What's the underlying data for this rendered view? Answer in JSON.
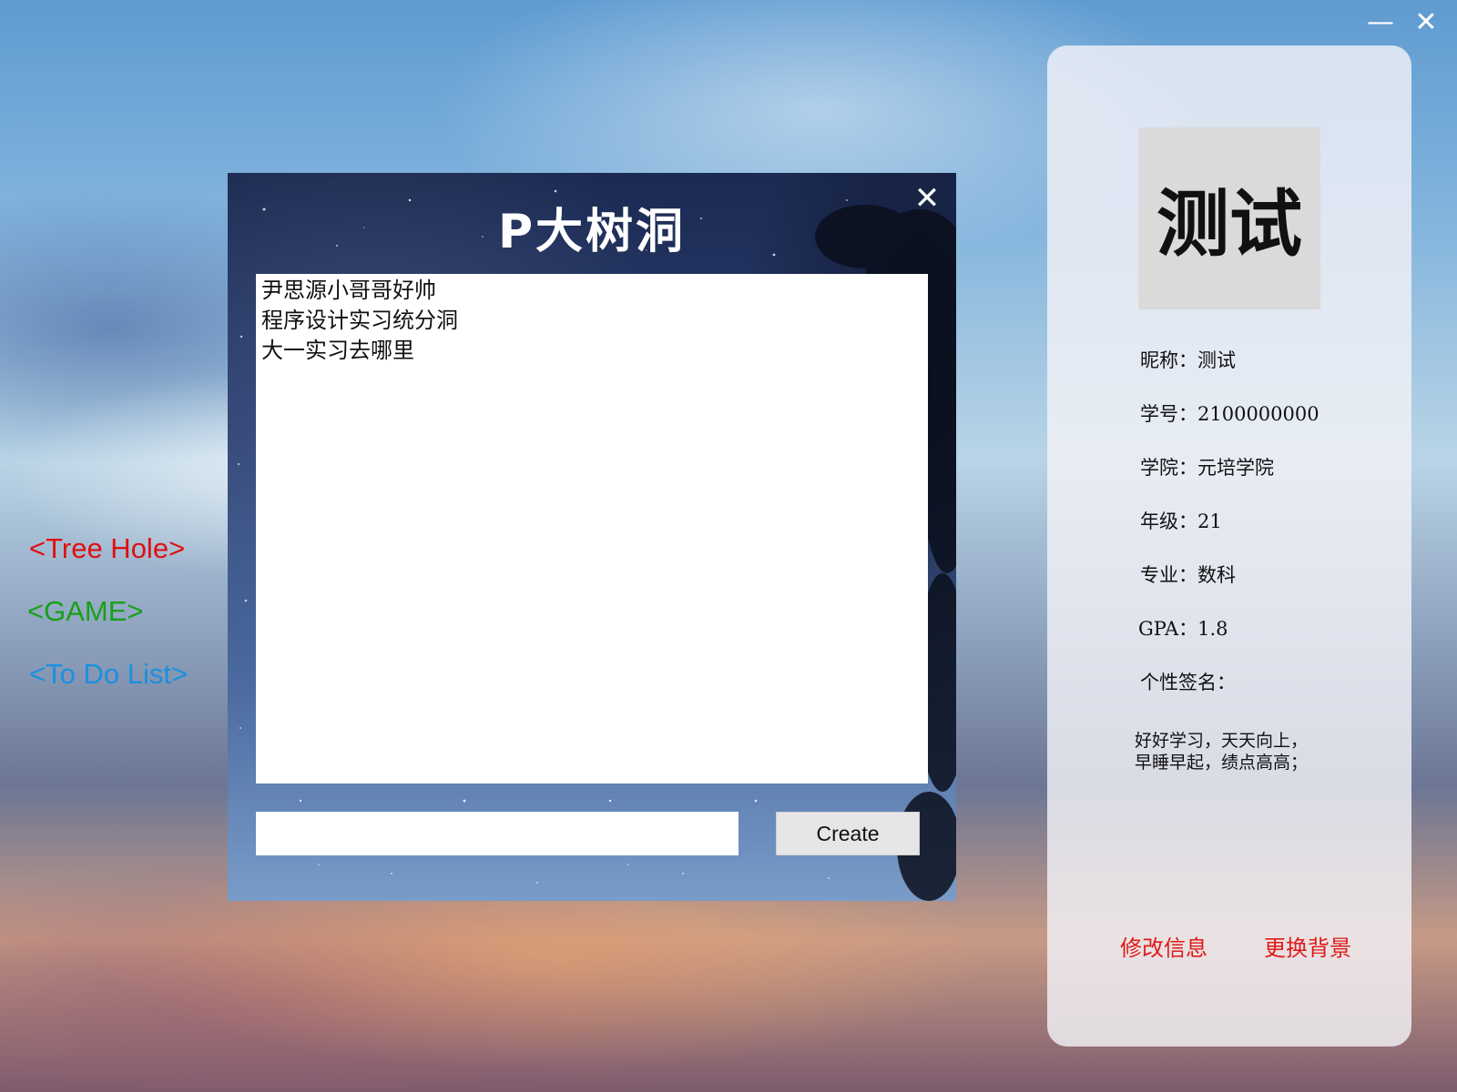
{
  "window": {
    "minimize_glyph": "—",
    "close_glyph": "✕"
  },
  "nav": {
    "tree_hole": "<Tree Hole>",
    "game": "<GAME>",
    "todo": "<To Do List>",
    "colors": {
      "tree_hole": "#e01010",
      "game": "#18a018",
      "todo": "#1a90e0"
    }
  },
  "dialog": {
    "title": "P大树洞",
    "close_glyph": "✕",
    "holes": [
      "尹思源小哥哥好帅",
      "程序设计实习统分洞",
      "大一实习去哪里"
    ],
    "input_value": "",
    "create_label": "Create"
  },
  "profile": {
    "avatar_text": "测试",
    "nickname": "昵称：测试",
    "student_id": "学号：2100000000",
    "college": "学院：元培学院",
    "grade": "年级：21",
    "major": "专业：数科",
    "gpa": "GPA：1.8",
    "signature_label": "个性签名：",
    "signature": "好好学习，天天向上，早睡早起，绩点高高；",
    "edit_info": "修改信息",
    "change_background": "更换背景",
    "link_color": "#e01a1a"
  }
}
